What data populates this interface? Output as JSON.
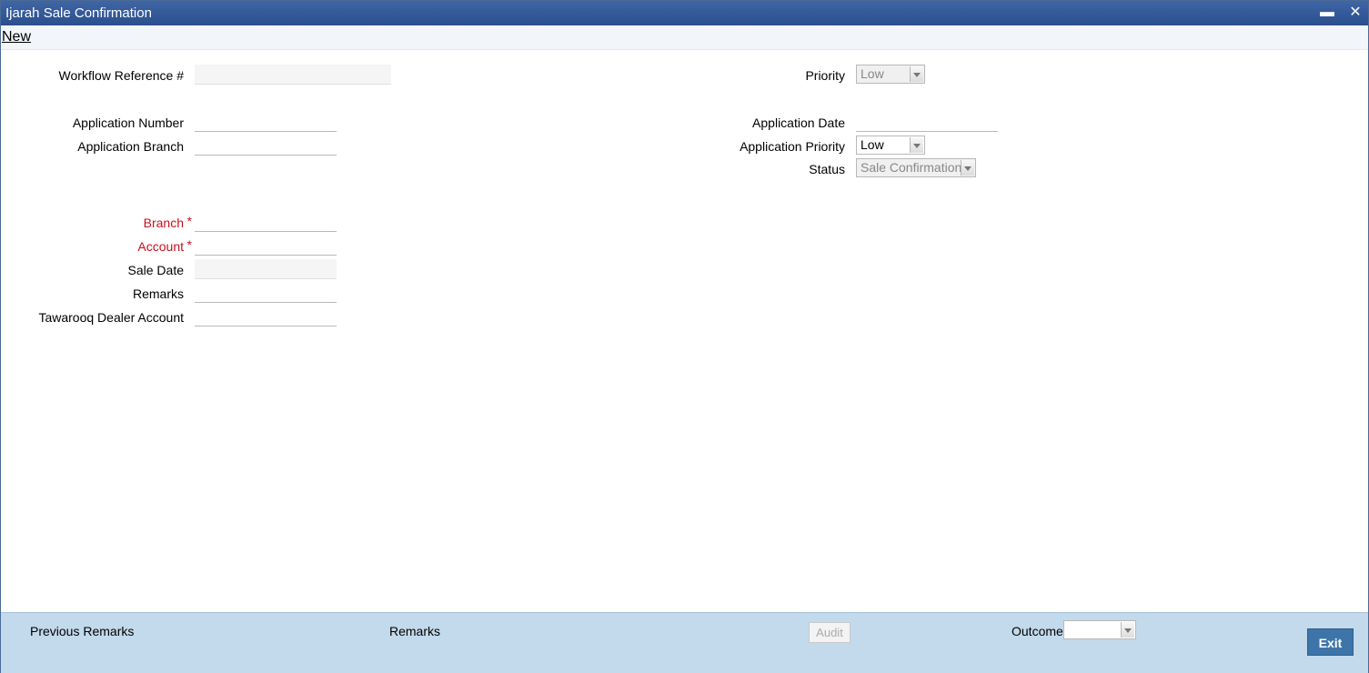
{
  "window": {
    "title": "Ijarah Sale Confirmation",
    "minimize_glyph": "▬",
    "close_glyph": "✕"
  },
  "menu": {
    "new_label": "New"
  },
  "form_left": {
    "workflow_reference_label": "Workflow Reference #",
    "workflow_reference_value": "",
    "application_number_label": "Application Number",
    "application_number_value": "",
    "application_branch_label": "Application Branch",
    "application_branch_value": "",
    "branch_label": "Branch",
    "branch_value": "",
    "account_label": "Account",
    "account_value": "",
    "sale_date_label": "Sale Date",
    "sale_date_value": "",
    "remarks_label": "Remarks",
    "remarks_value": "",
    "tawarooq_label": "Tawarooq Dealer Account",
    "tawarooq_value": "",
    "required_marker": "*"
  },
  "form_right": {
    "priority_label": "Priority",
    "priority_value": "Low",
    "application_date_label": "Application Date",
    "application_date_value": "",
    "application_priority_label": "Application Priority",
    "application_priority_value": "Low",
    "status_label": "Status",
    "status_value": "Sale Confirmation"
  },
  "footer": {
    "previous_remarks_label": "Previous Remarks",
    "remarks_label": "Remarks",
    "audit_label": "Audit",
    "outcome_label": "Outcome",
    "outcome_value": "",
    "exit_label": "Exit"
  },
  "colors": {
    "titlebar": "#2b4f8e",
    "required_label": "#c8101e",
    "footer_bg": "#c3d9ec",
    "exit_button": "#3e75a8"
  }
}
